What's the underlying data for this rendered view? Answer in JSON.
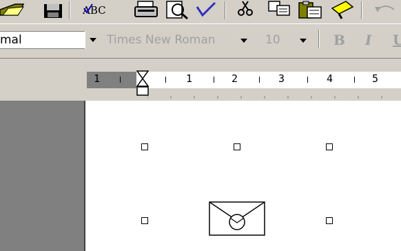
{
  "formatting": {
    "style_value": "mal",
    "font_value": "Times New Roman",
    "size_value": "10",
    "bold_label": "B",
    "italic_label": "I",
    "underline_label": "U"
  },
  "ruler": {
    "numbers": [
      "1",
      "1",
      "2",
      "3",
      "4",
      "5"
    ]
  },
  "icons": {
    "toolbar": [
      "open-folder-icon",
      "save-icon",
      "spelling-icon",
      "print-icon",
      "print-preview-icon",
      "spell-check-icon",
      "cut-icon",
      "copy-icon",
      "paste-icon",
      "format-painter-icon",
      "undo-icon"
    ],
    "document": [
      "selection-handle",
      "envelope-icon"
    ]
  }
}
